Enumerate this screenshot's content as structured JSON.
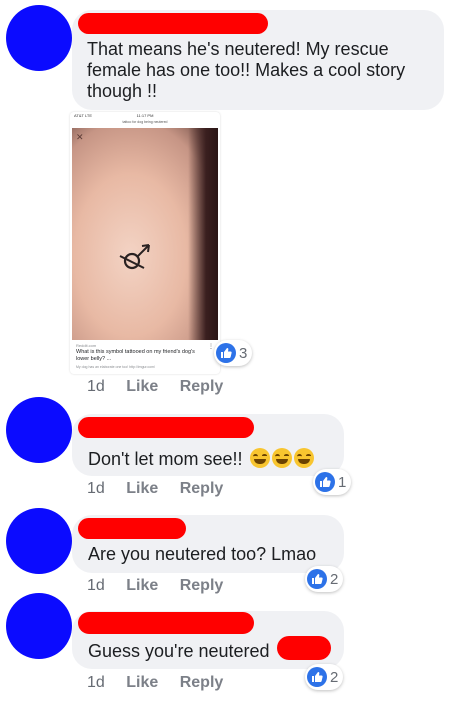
{
  "comments": [
    {
      "text_lines": [
        "That means he's neutered!  My rescue",
        "female has one too!!  Makes a cool story",
        "though !!"
      ],
      "time": "1d",
      "like_label": "Like",
      "reply_label": "Reply",
      "reaction_count": "3",
      "attachment": {
        "status_left": "AT&T  LTE",
        "status_time": "11:17 PM",
        "url_line": "tattoo for dog being neutered",
        "close_glyph": "✕",
        "source": "Reddit.com",
        "title": "What is this symbol tattooed on my friend's dog's lower belly? ...",
        "subtitle": "My dog has an elaborate one too! http://imgur.com/",
        "more_glyph": "⋮"
      }
    },
    {
      "text": "Don't let mom see!!",
      "emoji_count": 3,
      "time": "1d",
      "like_label": "Like",
      "reply_label": "Reply",
      "reaction_count": "1"
    },
    {
      "text": "Are you neutered too? Lmao",
      "time": "1d",
      "like_label": "Like",
      "reply_label": "Reply",
      "reaction_count": "2"
    },
    {
      "text": "Guess you're neutered",
      "time": "1d",
      "like_label": "Like",
      "reply_label": "Reply",
      "reaction_count": "2"
    }
  ],
  "colors": {
    "avatar": "#0b0bff",
    "redaction": "#ff0000",
    "bubble": "#f0f1f4",
    "like_reaction": "#2d72e8"
  },
  "icons": {
    "reaction": "thumbs-up-icon",
    "emoji": "laughing-emoji-icon",
    "avatar": "profile-avatar"
  }
}
